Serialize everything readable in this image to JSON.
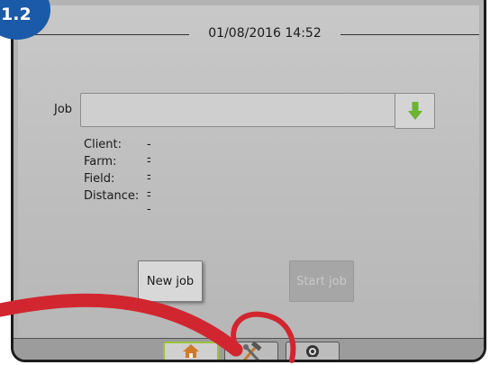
{
  "step_badge": "1.2",
  "header": {
    "datetime": "01/08/2016 14:52"
  },
  "job": {
    "label": "Job",
    "value": "",
    "dropdown_icon": "green-down-arrow-icon"
  },
  "details": [
    {
      "label": "Client:",
      "value": "--"
    },
    {
      "label": "Farm:",
      "value": "--"
    },
    {
      "label": "Field:",
      "value": "--"
    },
    {
      "label": "Distance:",
      "value": "--"
    }
  ],
  "buttons": {
    "new_job": "New job",
    "start_job": "Start job"
  },
  "tabs": [
    {
      "icon": "home-icon",
      "selected": true
    },
    {
      "icon": "tools-icon",
      "selected": false
    },
    {
      "icon": "camera-icon",
      "selected": false
    }
  ],
  "colors": {
    "accent_green": "#6ab42f",
    "badge_blue": "#1b5aa8",
    "highlight_red": "#d12630"
  }
}
